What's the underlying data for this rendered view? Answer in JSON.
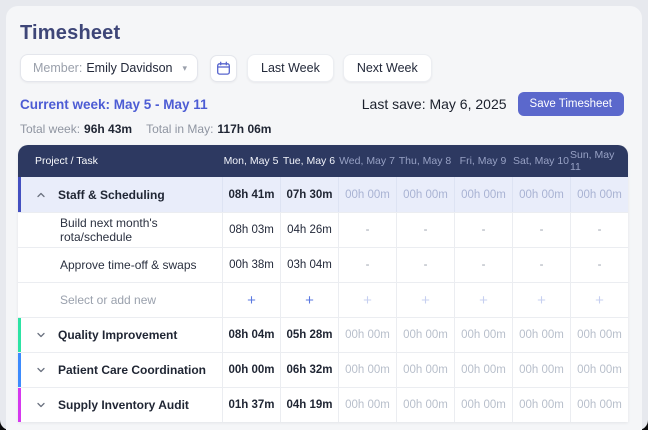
{
  "header": {
    "title": "Timesheet"
  },
  "toolbar": {
    "member_label": "Member:",
    "member_value": "Emily Davidson",
    "last_week": "Last Week",
    "next_week": "Next Week"
  },
  "weekbar": {
    "current_week": "Current week: May 5 - May 11",
    "last_save": "Last save: May 6, 2025",
    "save_button": "Save Timesheet"
  },
  "totals": {
    "week_label": "Total week:",
    "week_value": "96h 43m",
    "month_label": "Total in May:",
    "month_value": "117h 06m"
  },
  "colors": {
    "accent_indigo": "#5b68cc",
    "current_week_text": "#4c5cd4",
    "table_header_bg": "#2d3961",
    "expanded_row_bg": "#e9edfa",
    "project_accents": [
      "#4450c0",
      "#2de3a4",
      "#3d8bfd",
      "#d539ee"
    ]
  },
  "icons": [
    "calendar-icon",
    "dropdown-caret-icon",
    "chevron-up-icon",
    "chevron-down-icon",
    "plus-icon"
  ],
  "table": {
    "task_header": "Project / Task",
    "days": [
      "Mon, May 5",
      "Tue, May 6",
      "Wed, May 7",
      "Thu, May 8",
      "Fri, May 9",
      "Sat, May 10",
      "Sun, May 11"
    ],
    "active_day_count": 2,
    "rows": [
      {
        "type": "project",
        "label": "Staff & Scheduling",
        "expanded": true,
        "accent": "#4450c0",
        "values": [
          "08h 41m",
          "07h 30m",
          "00h 00m",
          "00h 00m",
          "00h 00m",
          "00h 00m",
          "00h 00m"
        ]
      },
      {
        "type": "task",
        "label": "Build next month's rota/schedule",
        "values": [
          "08h 03m",
          "04h 26m",
          "-",
          "-",
          "-",
          "-",
          "-"
        ]
      },
      {
        "type": "task",
        "label": "Approve time-off & swaps",
        "values": [
          "00h 38m",
          "03h 04m",
          "-",
          "-",
          "-",
          "-",
          "-"
        ]
      },
      {
        "type": "add",
        "label": "Select or add new",
        "values": [
          "+",
          "+",
          "+",
          "+",
          "+",
          "+",
          "+"
        ]
      },
      {
        "type": "project",
        "label": "Quality Improvement",
        "expanded": false,
        "accent": "#2de3a4",
        "values": [
          "08h 04m",
          "05h 28m",
          "00h 00m",
          "00h 00m",
          "00h 00m",
          "00h 00m",
          "00h 00m"
        ]
      },
      {
        "type": "project",
        "label": "Patient Care Coordination",
        "expanded": false,
        "accent": "#3d8bfd",
        "values": [
          "00h 00m",
          "06h 32m",
          "00h 00m",
          "00h 00m",
          "00h 00m",
          "00h 00m",
          "00h 00m"
        ]
      },
      {
        "type": "project",
        "label": "Supply Inventory Audit",
        "expanded": false,
        "accent": "#d539ee",
        "values": [
          "01h 37m",
          "04h 19m",
          "00h 00m",
          "00h 00m",
          "00h 00m",
          "00h 00m",
          "00h 00m"
        ]
      }
    ]
  }
}
